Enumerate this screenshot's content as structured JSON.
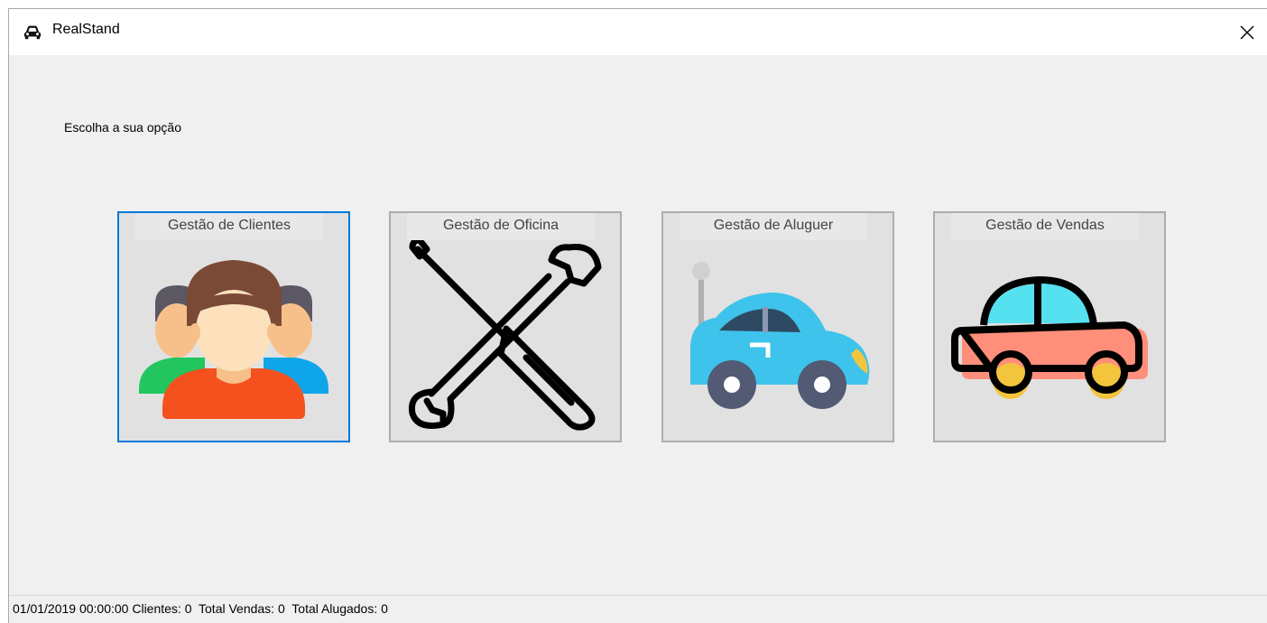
{
  "window": {
    "title": "RealStand",
    "app_icon": "car-icon",
    "close_icon": "close-icon"
  },
  "main": {
    "prompt": "Escolha a sua opção",
    "tiles": [
      {
        "label": "Gestão de Clientes",
        "icon": "users-group-icon",
        "focused": true
      },
      {
        "label": "Gestão de Oficina",
        "icon": "wrench-screwdriver-icon",
        "focused": false
      },
      {
        "label": "Gestão de Aluguer",
        "icon": "rental-car-icon",
        "focused": false
      },
      {
        "label": "Gestão de Vendas",
        "icon": "sale-car-icon",
        "focused": false
      }
    ]
  },
  "statusbar": {
    "text": "01/01/2019 00:00:00 Clientes: 0  Total Vendas: 0  Total Alugados: 0"
  },
  "colors": {
    "focus_border": "#0078d7",
    "tile_background": "#e1e1e1",
    "window_background": "#f0f0f0"
  }
}
